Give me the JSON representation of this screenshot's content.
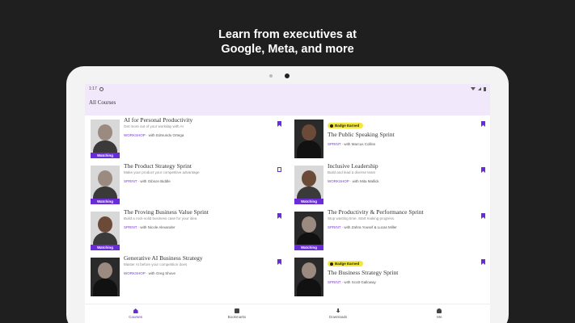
{
  "headline": {
    "line1": "Learn from executives at",
    "line2": "Google, Meta, and more"
  },
  "status": {
    "time": "1:17"
  },
  "appbar": {
    "title": "All Courses"
  },
  "courses": [
    {
      "title": "AI for Personal Productivity",
      "desc": "Get more out of your workday with AI",
      "type": "WORKSHOP",
      "instructor": "Edmundo Ortega",
      "watching": "Watching",
      "bookmarked": true
    },
    {
      "title": "The Public Speaking Sprint",
      "desc": "",
      "type": "SPRINT",
      "instructor": "Marcus Collins",
      "badge": "Badge Earned",
      "bookmarked": true
    },
    {
      "title": "The Product Strategy Sprint",
      "desc": "Make your product your competitive advantage",
      "type": "SPRINT",
      "instructor": "Gibson Biddle",
      "watching": "Watching",
      "bookmarked": false
    },
    {
      "title": "Inclusive Leadership",
      "desc": "Build and lead a diverse team",
      "type": "WORKSHOP",
      "instructor": "Mita Mallick",
      "watching": "Watching",
      "bookmarked": true
    },
    {
      "title": "The Proving Business Value Sprint",
      "desc": "Build a rock-solid business case for your idea",
      "type": "SPRINT",
      "instructor": "Nicole Alexander",
      "watching": "Watching",
      "bookmarked": true
    },
    {
      "title": "The Productivity & Performance Sprint",
      "desc": "Stop wasting time. Start making progress.",
      "type": "SPRINT",
      "instructor": "Zahra Yousef & Lucas Miller",
      "watching": "Watching",
      "bookmarked": true
    },
    {
      "title": "Generative AI Business Strategy",
      "desc": "Master AI before your competition does",
      "type": "WORKSHOP",
      "instructor": "Greg Shove",
      "bookmarked": true
    },
    {
      "title": "The Business Strategy Sprint",
      "desc": "",
      "type": "SPRINT",
      "instructor": "Scott Galloway",
      "badge": "Badge Earned",
      "bookmarked": true
    }
  ],
  "with_prefix": "· with",
  "nav": [
    {
      "label": "Courses",
      "icon": "home-icon"
    },
    {
      "label": "Bookmarks",
      "icon": "book-icon"
    },
    {
      "label": "Downloads",
      "icon": "download-icon"
    },
    {
      "label": "Me",
      "icon": "user-icon"
    }
  ],
  "colors": {
    "accent": "#6a2cd6",
    "badge": "#f3e83a",
    "appbar": "#f1e8fb"
  }
}
